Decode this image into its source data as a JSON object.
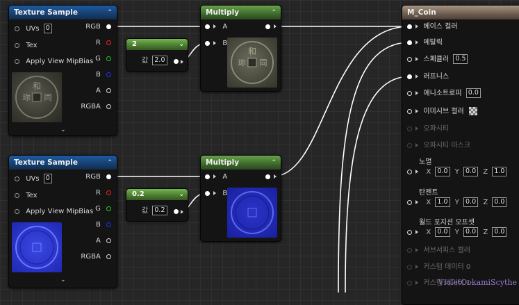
{
  "texture_sample_1": {
    "title": "Texture Sample",
    "uvs_label": "UVs",
    "uvs_value": "0",
    "tex_label": "Tex",
    "mip_label": "Apply View MipBias",
    "out_rgb": "RGB",
    "out_r": "R",
    "out_g": "G",
    "out_b": "B",
    "out_a": "A",
    "out_rgba": "RGBA",
    "thumbnail_chars": [
      "和",
      "同",
      "珎"
    ]
  },
  "texture_sample_2": {
    "title": "Texture Sample",
    "uvs_label": "UVs",
    "uvs_value": "0",
    "tex_label": "Tex",
    "mip_label": "Apply View MipBias",
    "out_rgb": "RGB",
    "out_r": "R",
    "out_g": "G",
    "out_b": "B",
    "out_a": "A",
    "out_rgba": "RGBA"
  },
  "constant_1": {
    "title": "2",
    "value_label": "값",
    "value": "2.0"
  },
  "constant_2": {
    "title": "0.2",
    "value_label": "값",
    "value": "0.2"
  },
  "multiply_1": {
    "title": "Multiply",
    "in_a": "A",
    "in_b": "B"
  },
  "multiply_2": {
    "title": "Multiply",
    "in_a": "A",
    "in_b": "B"
  },
  "material": {
    "title": "M_Coin",
    "pins": {
      "base_color": "베이스 컬러",
      "metallic": "메탈릭",
      "specular": "스페큘러",
      "specular_value": "0.5",
      "roughness": "러프니스",
      "anisotropy": "애니소트로피",
      "anisotropy_value": "0.0",
      "emissive": "이미시브 컬러",
      "opacity": "오파시티",
      "opacity_mask": "오파시티 마스크",
      "normal": "노멀",
      "normal_x": "0.0",
      "normal_y": "0.0",
      "normal_z": "1.0",
      "tangent": "탄젠트",
      "tangent_x": "1.0",
      "tangent_y": "0.0",
      "tangent_z": "0.0",
      "wpo": "월드 포지션 오프셋",
      "wpo_x": "0.0",
      "wpo_y": "0.0",
      "wpo_z": "0.0",
      "subsurface": "서브서피스 컬러",
      "custom0": "커스텀 데이터 0",
      "custom1": "커스텀 데이터 1"
    },
    "axis_x": "X",
    "axis_y": "Y",
    "axis_z": "Z"
  },
  "watermark": "VioletOokamiScythe",
  "colors": {
    "background": "#262626",
    "wire": "#ffffff",
    "pin_r": "#ff2020",
    "pin_g": "#20d020",
    "pin_b": "#2030ff"
  }
}
